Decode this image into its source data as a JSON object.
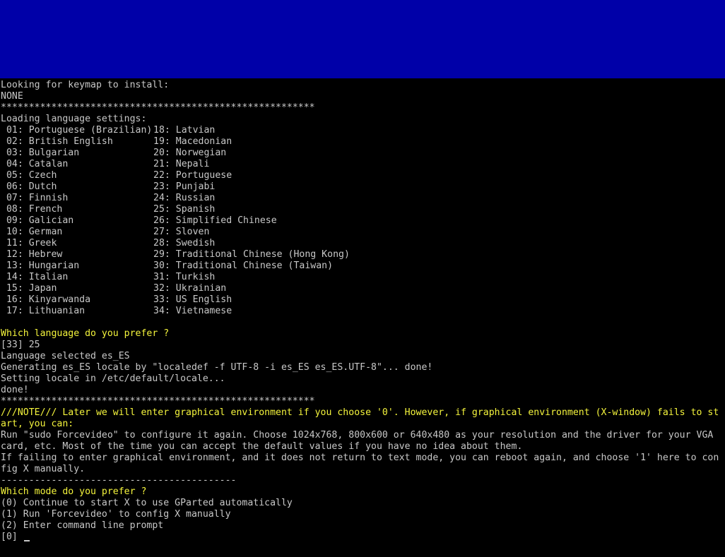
{
  "top_band_color": "#0000a8",
  "colors": {
    "text": "#c8c8c8",
    "highlight": "#f4f43c",
    "background": "#000000"
  },
  "keymap": {
    "heading": "Looking for keymap to install:",
    "value": "NONE"
  },
  "separator": "********************************************************",
  "language": {
    "loading": "Loading language settings:",
    "left_column": [
      " 01: Portuguese (Brazilian)",
      " 02: British English",
      " 03: Bulgarian",
      " 04: Catalan",
      " 05: Czech",
      " 06: Dutch",
      " 07: Finnish",
      " 08: French",
      " 09: Galician",
      " 10: German",
      " 11: Greek",
      " 12: Hebrew",
      " 13: Hungarian",
      " 14: Italian",
      " 15: Japan",
      " 16: Kinyarwanda",
      " 17: Lithuanian"
    ],
    "right_column": [
      "18: Latvian",
      "19: Macedonian",
      "20: Norwegian",
      "21: Nepali",
      "22: Portuguese",
      "23: Punjabi",
      "24: Russian",
      "25: Spanish",
      "26: Simplified Chinese",
      "27: Sloven",
      "28: Swedish",
      "29: Traditional Chinese (Hong Kong)",
      "30: Traditional Chinese (Taiwan)",
      "31: Turkish",
      "32: Ukrainian",
      "33: US English",
      "34: Vietnamese"
    ],
    "question": "Which language do you prefer ?",
    "answer": "[33] 25",
    "selected": "Language selected es_ES",
    "generating": "Generating es_ES locale by \"localedef -f UTF-8 -i es_ES es_ES.UTF-8\"... done!",
    "setting": "Setting locale in /etc/default/locale...",
    "done": "done!"
  },
  "note": {
    "line1": "///NOTE/// Later we will enter graphical environment if you choose '0'. However, if graphical environment (X-window) fails to st",
    "line2": "art, you can:",
    "run1": "Run \"sudo Forcevideo\" to configure it again. Choose 1024x768, 800x600 or 640x480 as your resolution and the driver for your VGA",
    "run2": "card, etc. Most of the time you can accept the default values if you have no idea about them.",
    "fail1": "If failing to enter graphical environment, and it does not return to text mode, you can reboot again, and choose '1' here to con",
    "fail2": "fig X manually."
  },
  "dash_separator": "------------------------------------------",
  "mode": {
    "question": "Which mode do you prefer ?",
    "options": [
      "(0) Continue to start X to use GParted automatically",
      "(1) Run 'Forcevideo' to config X manually",
      "(2) Enter command line prompt"
    ],
    "prompt": "[0] "
  }
}
